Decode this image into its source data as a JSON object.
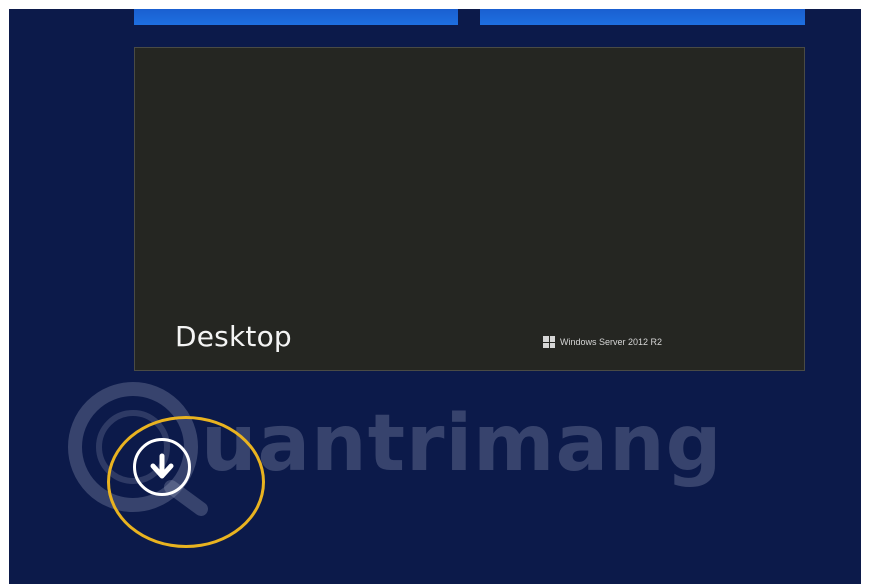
{
  "start_screen": {
    "tiles": {
      "desktop": {
        "label": "Desktop",
        "brand_text": "Windows Server 2012 R2"
      }
    },
    "apps_button": {
      "icon": "arrow-down-circle-icon"
    }
  },
  "watermark": {
    "text": "uantrimang"
  },
  "colors": {
    "background": "#0c1a4a",
    "tile_dark": "#252622",
    "tile_blue": "#1e6fe0",
    "highlight": "#e9b320"
  }
}
